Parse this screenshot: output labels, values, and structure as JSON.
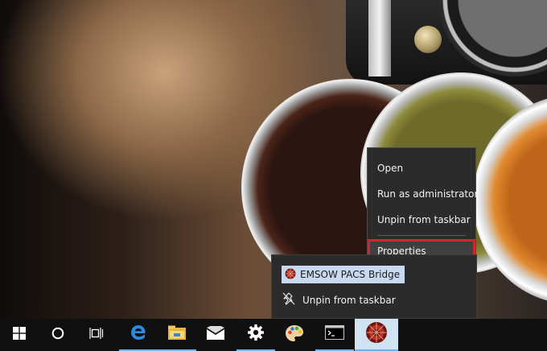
{
  "context_menu": {
    "items": [
      {
        "label": "Open"
      },
      {
        "label": "Run as administrator"
      },
      {
        "label": "Unpin from taskbar"
      },
      {
        "label": "Properties"
      }
    ]
  },
  "jumplist": {
    "app_name": "EMSOW PACS Bridge",
    "unpin_label": "Unpin from taskbar"
  },
  "taskbar": {
    "buttons": [
      {
        "name": "start",
        "icon": "windows-logo-icon"
      },
      {
        "name": "cortana",
        "icon": "cortana-circle-icon"
      },
      {
        "name": "task-view",
        "icon": "task-view-icon"
      },
      {
        "name": "edge",
        "icon": "edge-browser-icon"
      },
      {
        "name": "file-explorer",
        "icon": "folder-icon"
      },
      {
        "name": "mail",
        "icon": "mail-icon"
      },
      {
        "name": "settings",
        "icon": "gear-icon"
      },
      {
        "name": "paint",
        "icon": "paint-palette-icon"
      },
      {
        "name": "command-prompt",
        "icon": "terminal-icon"
      },
      {
        "name": "emsow-pacs-bridge",
        "icon": "emsow-app-icon"
      }
    ]
  },
  "colors": {
    "highlight_border": "#d4252f",
    "taskbar_active": "#6fb3e8",
    "menu_background": "#2b2b2b"
  }
}
